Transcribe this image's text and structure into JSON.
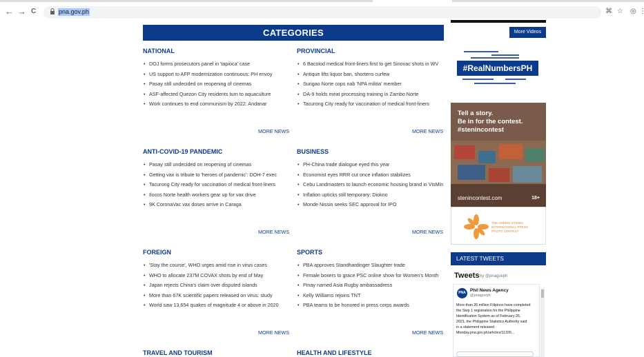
{
  "browser": {
    "url": "pna.gov.ph",
    "back_glyph": "←",
    "forward_glyph": "→",
    "reload_glyph": "C",
    "right_icons": [
      "⌘",
      "☆",
      "◎",
      "⋮"
    ]
  },
  "categories_title": "CATEGORIES",
  "more_news_label": "MORE NEWS",
  "sections": {
    "national": {
      "title": "NATIONAL",
      "items": [
        "DOJ forms prosecutors panel in 'tapioca' case",
        "US support to AFP modernization continuous: PH envoy",
        "Pasay still undecided on reopening of cinemas",
        "ASF-affected Quezon City residents turn to aquaculture",
        "Work continues to end communism by 2022: Andanar"
      ]
    },
    "provincial": {
      "title": "PROVINCIAL",
      "items": [
        "6 Bacolod medical front-liners first to get Sinovac shots in WV",
        "Antique lifts liquor ban, shortens curfew",
        "Surigao Norte cops nab 'NPA militia' member",
        "DA-9 holds meat processing training in Zambo Norte",
        "Tacurong City ready for vaccination of medical front-liners"
      ]
    },
    "covid": {
      "title": "ANTI-COVID-19 PANDEMIC",
      "items": [
        "Pasay still undecided on reopening of cinemas",
        "Getting vax is tribute to 'heroes of pandemic': DOH-7 exec",
        "Tacurong City ready for vaccination of medical front-liners",
        "Ilocos Norte health workers gear up for vax drive",
        "9K CoronaVac vax doses arrive in Caraga"
      ]
    },
    "business": {
      "title": "BUSINESS",
      "items": [
        "PH-China trade dialogue eyed this year",
        "Economist eyes RRR cut once inflation stabilizes",
        "Cebu Landmasters to launch economic housing brand in VisMin",
        "Inflation upticks still temporary: Diokno",
        "Monde Nissin seeks SEC approval for IPO"
      ]
    },
    "foreign": {
      "title": "FOREIGN",
      "items": [
        "'Stay the course', WHO urges amid rise in virus cases",
        "WHO to allocate 237M COVAX shots by end of May",
        "Japan rejects China's claim over disputed islands",
        "More than 67K scientific papers released on virus: study",
        "World saw 13,654 quakes of magnitude 4 or above in 2020"
      ]
    },
    "sports": {
      "title": "SPORTS",
      "items": [
        "PBA approves Standhardinger Slaughter trade",
        "Female boxers to grace PSC online show for Women's Month",
        "Pinay named Asia Rugby ambassadress",
        "Kelly Williams rejoins TNT",
        "PBA teams to be honored in press corps awards"
      ]
    },
    "travel": {
      "title": "TRAVEL AND TOURISM"
    },
    "health": {
      "title": "HEALTH AND LIFESTYLE"
    }
  },
  "sidebar": {
    "more_videos": "More Videos",
    "realnumbers": "#RealNumbersPH",
    "ad_text_1": "Tell a story.",
    "ad_text_2": "Be in for the contest.",
    "ad_text_3": "#stenincontest",
    "ad_url": "stenincontest.com",
    "ad_age": "18+",
    "ad_bottom_text": "THE ANDREI STENIN INTERNATIONAL PRESS PHOTO CONTEST",
    "latest_tweets": "LATEST TWEETS",
    "tweets_heading": "Tweets",
    "tweets_by": "by @pnagovph",
    "tweet_avatar": "PNA",
    "tweet_name": "Phil News Agency",
    "tweet_handle": "@pnagovph",
    "tweet_body": "More than 26 million Filipinos have completed the Step 1 registration for the Philippine Identification System as of February 26, 2021, the Philippine Statistics Authority said in a statement released Monday.pna.gov.ph/articles/11326..."
  },
  "colors": {
    "brand_blue": "#0c3b8c"
  }
}
